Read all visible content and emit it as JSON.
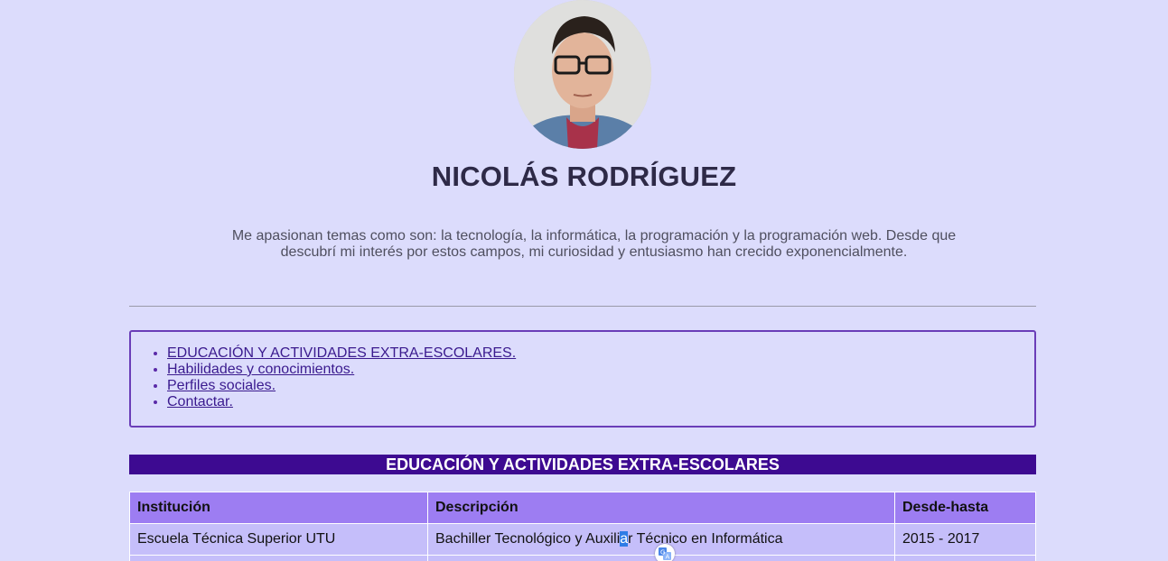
{
  "profile": {
    "name": "NICOLÁS RODRÍGUEZ",
    "bio": "Me apasionan temas como son: la tecnología, la informática, la programación y la programación web. Desde que descubrí mi interés por estos campos, mi curiosidad y entusiasmo han crecido exponencialmente."
  },
  "nav": {
    "items": [
      {
        "label": "EDUCACIÓN Y ACTIVIDADES EXTRA-ESCOLARES."
      },
      {
        "label": "Habilidades y conocimientos."
      },
      {
        "label": "Perfiles sociales."
      },
      {
        "label": "Contactar."
      }
    ]
  },
  "education": {
    "title": "EDUCACIÓN Y ACTIVIDADES EXTRA-ESCOLARES",
    "headers": [
      "Institución",
      "Descripción",
      "Desde-hasta"
    ],
    "rows": [
      {
        "institution": "Escuela Técnica Superior UTU",
        "description_before": "Bachiller Tecnológico y Auxili",
        "description_selected": "a",
        "description_after": "r Técnico en Informática",
        "period": "2015 - 2017"
      }
    ]
  },
  "colors": {
    "background": "#dcdcfc",
    "accent": "#3d0a91",
    "table_header": "#9d7df2",
    "table_cell": "#c5befa",
    "border": "#6a3db8"
  },
  "icons": {
    "translate": "translate-icon"
  }
}
